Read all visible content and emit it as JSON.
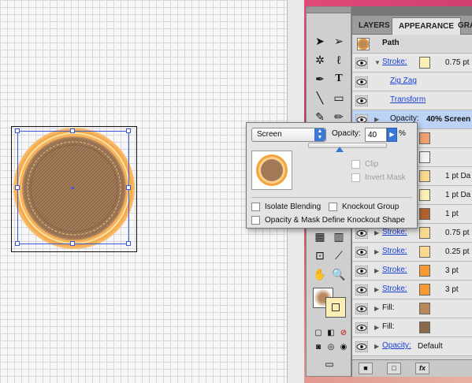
{
  "panel": {
    "tabs": [
      "LAYERS",
      "APPEARANCE",
      "GRA"
    ],
    "active_tab": "APPEARANCE",
    "header_title": "Path",
    "rows": [
      {
        "label": "Stroke:",
        "type": "link",
        "expanded": true,
        "swatch": "#fcefb6",
        "value": "0.75 pt"
      },
      {
        "label": "Zig Zag",
        "type": "link",
        "indent": true
      },
      {
        "label": "Transform",
        "type": "link",
        "indent": true
      },
      {
        "label": "Opacity:",
        "type": "highlight",
        "value": "40% Screen"
      },
      {
        "label": "",
        "type": "hidden-row",
        "swatch": "#f0a070"
      },
      {
        "label": "",
        "type": "hidden-row",
        "swatch": "#f2f2f2"
      },
      {
        "label": "",
        "type": "hidden-row",
        "swatch": "#f8d98f",
        "value": "1 pt Da"
      },
      {
        "label": "",
        "type": "hidden-row",
        "swatch": "#fcefb6",
        "value": "1 pt Da"
      },
      {
        "label": "",
        "type": "hidden-row",
        "swatch": "#b0622e",
        "value": "1 pt"
      },
      {
        "label": "Stroke:",
        "type": "link",
        "swatch": "#f8d98f",
        "value": "0.75 pt"
      },
      {
        "label": "Stroke:",
        "type": "link",
        "swatch": "#f8d98f",
        "value": "0.25 pt"
      },
      {
        "label": "Stroke:",
        "type": "link",
        "swatch": "#f59a33",
        "value": "3 pt"
      },
      {
        "label": "Stroke:",
        "type": "link",
        "swatch": "#f59a33",
        "value": "3 pt"
      },
      {
        "label": "Fill:",
        "type": "plain",
        "swatch": "#b9875a"
      },
      {
        "label": "Fill:",
        "type": "plain",
        "swatch": "#8a6a4a"
      },
      {
        "label": "Opacity:",
        "type": "link",
        "value": "Default"
      }
    ]
  },
  "transparency_popup": {
    "blend_mode": "Screen",
    "opacity_label": "Opacity:",
    "opacity_value": "40",
    "percent_sign": "%",
    "clip_label": "Clip",
    "invert_mask_label": "Invert Mask",
    "isolate_blending_label": "Isolate Blending",
    "knockout_group_label": "Knockout Group",
    "opacity_mask_label": "Opacity & Mask Define Knockout Shape"
  },
  "colors": {
    "selection": "#3b5bd6",
    "highlight_row": "#bcd3f5",
    "link_text": "#1b3fd4",
    "button_blue": "#3a78d8"
  }
}
